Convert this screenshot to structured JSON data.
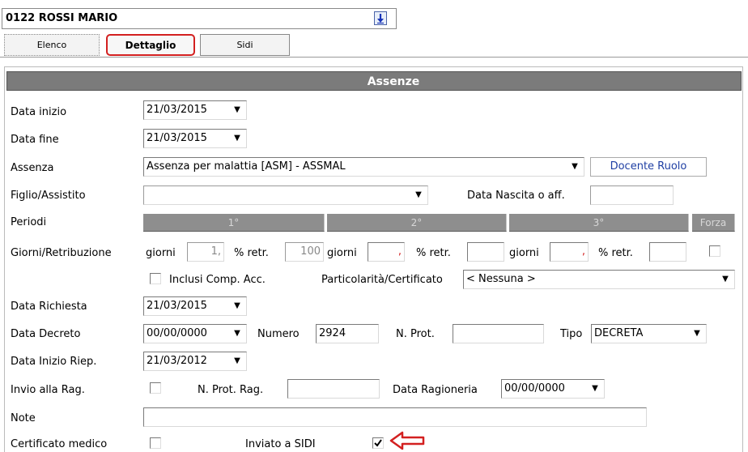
{
  "header": {
    "title": "0122 ROSSI MARIO",
    "title_dropdown_icon": "blue-down-arrow-icon"
  },
  "tabs": [
    {
      "label": "Elenco"
    },
    {
      "label": "Dettaglio"
    },
    {
      "label": "Sidi"
    }
  ],
  "section": {
    "title": "Assenze"
  },
  "form": {
    "data_inizio": {
      "label": "Data inizio",
      "value": "21/03/2015"
    },
    "data_fine": {
      "label": "Data fine",
      "value": "21/03/2015"
    },
    "assenza": {
      "label": "Assenza",
      "value": "Assenza per malattia [ASM] - ASSMAL",
      "role": "Docente Ruolo"
    },
    "figlio": {
      "label": "Figlio/Assistito",
      "value": "",
      "data_nascita_label": "Data Nascita o aff.",
      "data_nascita_value": ""
    },
    "periodi": {
      "label": "Periodi",
      "p1": "1°",
      "p2": "2°",
      "p3": "3°",
      "forza": "Forza"
    },
    "giorni": {
      "label": "Giorni/Retribuzione",
      "giorni_label": "giorni",
      "retr_label": "% retr.",
      "g1": "1,",
      "r1": "100",
      "g2": ",",
      "r2": "",
      "g3": ",",
      "r3": ""
    },
    "inclusi": {
      "label": "Inclusi Comp. Acc.",
      "part_label": "Particolarità/Certificato",
      "part_value": "< Nessuna >"
    },
    "data_richiesta": {
      "label": "Data Richiesta",
      "value": "21/03/2015"
    },
    "data_decreto": {
      "label": "Data Decreto",
      "value": "00/00/0000",
      "numero_label": "Numero",
      "numero_value": "2924",
      "nprot_label": "N. Prot.",
      "nprot_value": "",
      "tipo_label": "Tipo",
      "tipo_value": "DECRETA"
    },
    "data_inizio_riep": {
      "label": "Data Inizio Riep.",
      "value": "21/03/2012"
    },
    "invio_rag": {
      "label": "Invio alla Rag.",
      "nprot_rag_label": "N. Prot. Rag.",
      "nprot_rag_value": "",
      "data_rag_label": "Data Ragioneria",
      "data_rag_value": "00/00/0000"
    },
    "note": {
      "label": "Note",
      "value": ""
    },
    "certificato": {
      "label": "Certificato medico",
      "inviato_label": "Inviato a SIDI",
      "inviato_checked": true
    }
  },
  "colors": {
    "section_bar": "#7b7b7b",
    "highlight": "#d32020",
    "role_text": "#1f3fa3"
  }
}
